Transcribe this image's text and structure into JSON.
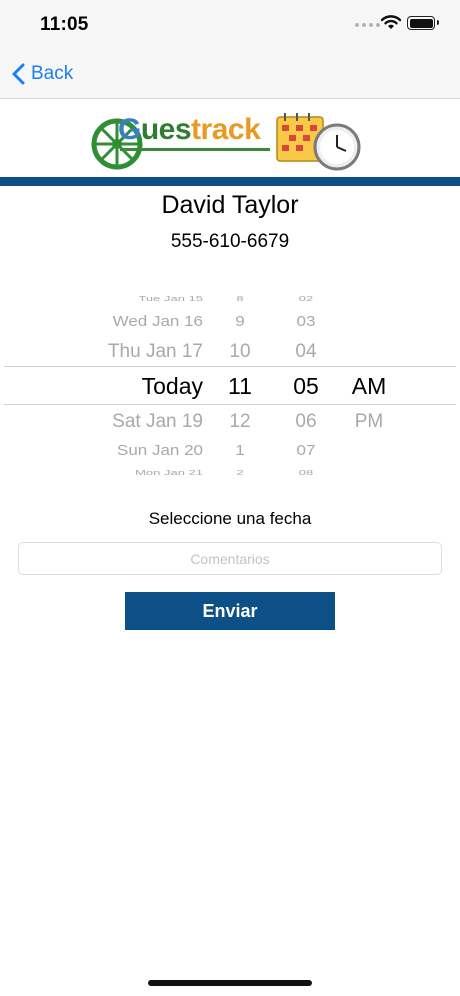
{
  "status_bar": {
    "time": "11:05"
  },
  "nav": {
    "back_label": "Back"
  },
  "logo": {
    "text_g": "G",
    "text_ues": "ues",
    "text_track": "track"
  },
  "contact": {
    "name": "David Taylor",
    "phone": "555-610-6679"
  },
  "picker": {
    "dates": [
      "Tue Jan 15",
      "Wed Jan 16",
      "Thu Jan 17",
      "Today",
      "Sat Jan 19",
      "Sun Jan 20",
      "Mon Jan 21"
    ],
    "hours": [
      "8",
      "9",
      "10",
      "11",
      "12",
      "1",
      "2"
    ],
    "minutes": [
      "02",
      "03",
      "04",
      "05",
      "06",
      "07",
      "08"
    ],
    "periods": [
      "AM",
      "PM"
    ],
    "selected_index": 3
  },
  "form": {
    "prompt": "Seleccione una fecha",
    "comments_placeholder": "Comentarios",
    "comments_value": "",
    "submit_label": "Enviar"
  },
  "colors": {
    "brand_blue": "#0c5087",
    "ios_blue": "#1a7ef5"
  },
  "icons": [
    "chevron-left-icon",
    "wifi-icon",
    "battery-icon",
    "wheel-logo-icon",
    "calendar-clock-icon"
  ]
}
